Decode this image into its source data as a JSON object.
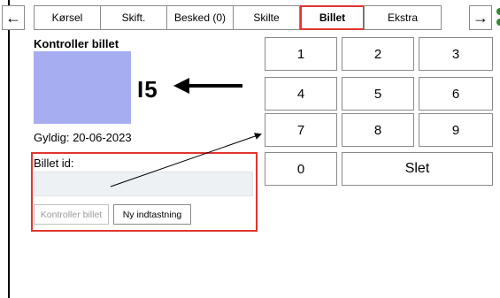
{
  "tabs": [
    {
      "label": "Kørsel",
      "active": false
    },
    {
      "label": "Skift.",
      "active": false
    },
    {
      "label": "Besked (0)",
      "active": false
    },
    {
      "label": "Skilte",
      "active": false
    },
    {
      "label": "Billet",
      "active": true
    },
    {
      "label": "Ekstra",
      "active": false
    }
  ],
  "nav": {
    "back_icon": "←",
    "forward_icon": "→"
  },
  "panel": {
    "title": "Kontroller billet",
    "annotation": "I5",
    "valid_label": "Gyldig: 20-06-2023",
    "ticket_id_label": "Billet id:",
    "ticket_id_value": "",
    "check_button": "Kontroller billet",
    "new_entry_button": "Ny indtastning"
  },
  "keypad": {
    "keys": [
      "1",
      "2",
      "3",
      "4",
      "5",
      "6",
      "7",
      "8",
      "9",
      "0"
    ],
    "delete_label": "Slet"
  },
  "colors": {
    "highlight": "#e0352f",
    "ticket_image": "#a6adf0",
    "accent_green": "#2e8b2e"
  }
}
